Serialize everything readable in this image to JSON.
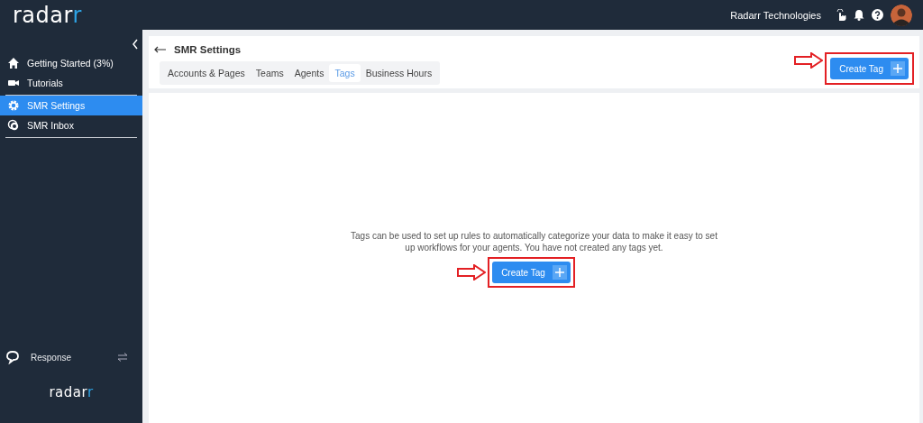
{
  "topbar": {
    "logo": {
      "text": "radar",
      "accent": "r"
    },
    "company": "Radarr Technologies"
  },
  "sidebar": {
    "items": [
      {
        "label": "Getting Started (3%)",
        "selected": false,
        "separator": false
      },
      {
        "label": "Tutorials",
        "selected": false,
        "separator": true
      },
      {
        "label": "SMR Settings",
        "selected": true,
        "separator": false
      },
      {
        "label": "SMR Inbox",
        "selected": false,
        "separator": true
      }
    ],
    "footer": {
      "label": "Response"
    },
    "footer_logo": {
      "text": "radar",
      "accent": "r"
    }
  },
  "header": {
    "title": "SMR Settings",
    "tabs": [
      {
        "label": "Accounts & Pages",
        "selected": false
      },
      {
        "label": "Teams",
        "selected": false
      },
      {
        "label": "Agents",
        "selected": false
      },
      {
        "label": "Tags",
        "selected": true
      },
      {
        "label": "Business Hours",
        "selected": false
      }
    ],
    "button": {
      "label": "Create Tag",
      "highlighted": true
    }
  },
  "empty_state": {
    "message": "Tags can be used to set up rules to automatically categorize your data to make it easy to set up workflows for your agents. You have not created any tags yet.",
    "button": {
      "label": "Create Tag",
      "highlighted": true
    }
  }
}
